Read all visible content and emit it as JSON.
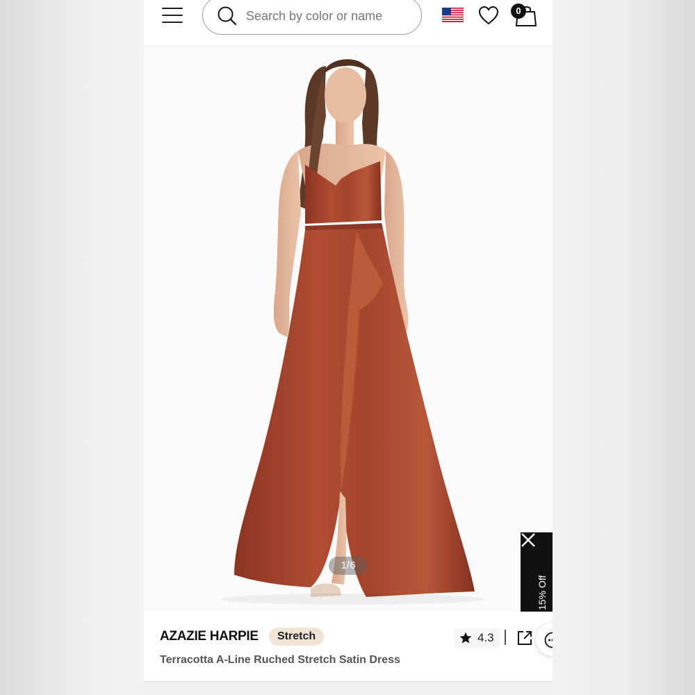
{
  "header": {
    "menu_icon": "hamburger-menu-icon",
    "search": {
      "placeholder": "Search by color or name",
      "value": "",
      "icon": "search-icon"
    },
    "flag_icon": "us-flag-icon",
    "wishlist_icon": "heart-icon",
    "cart": {
      "icon": "shopping-bag-icon",
      "count": "0"
    }
  },
  "gallery": {
    "image_counter": "1/6",
    "dress_color": "#a2442c"
  },
  "promo": {
    "label": "15% Off",
    "close_icon": "close-icon"
  },
  "product": {
    "brand": "AZAZIE HARPIE",
    "tag": "Stretch",
    "name": "Terracotta A-Line Ruched Stretch Satin Dress",
    "rating": "4.3",
    "rating_icon": "star-icon",
    "share_icon": "share-icon",
    "more_icon": "more-options-icon"
  },
  "colors": {
    "accent": "#111111",
    "tag_bg": "#efe4d6",
    "terracotta": "#a2442c"
  }
}
